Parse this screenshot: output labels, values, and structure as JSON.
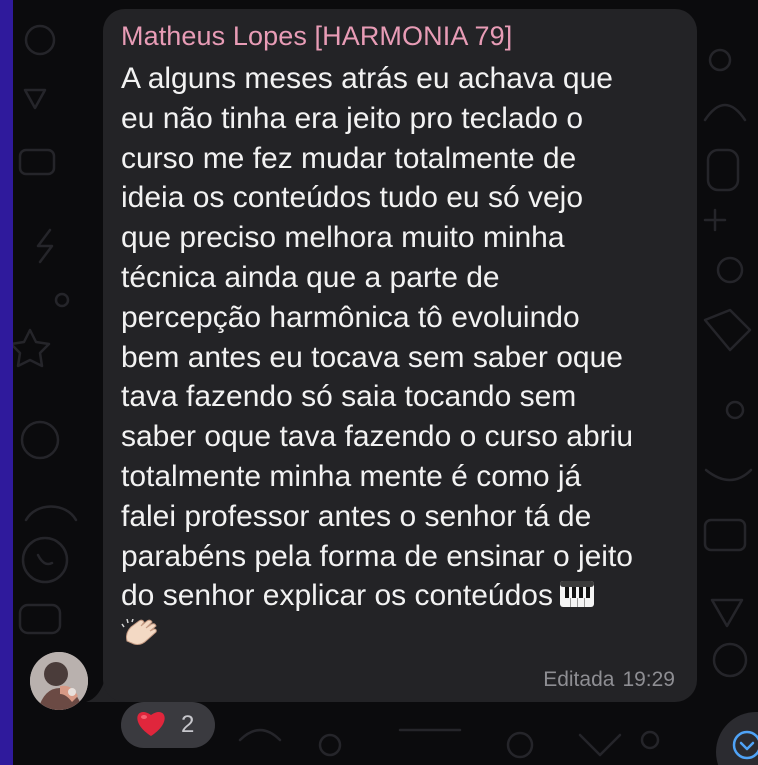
{
  "message": {
    "sender": "Matheus Lopes [HARMONIA 79]",
    "lines": [
      "A alguns meses atrás eu achava que",
      "eu não tinha era jeito pro teclado o",
      "curso me fez mudar totalmente de",
      "ideia os conteúdos tudo eu só vejo",
      "que preciso melhora muito minha",
      "técnica ainda que a parte de",
      "percepção harmônica tô evoluindo",
      "bem antes eu tocava sem saber oque",
      "tava fazendo só saia tocando sem",
      "saber oque tava fazendo o curso abriu",
      "totalmente minha mente é como já",
      "falei professor antes o senhor tá de",
      "parabéns pela forma de ensinar o jeito",
      "do senhor explicar os conteúdos"
    ],
    "emoji_icons": [
      "piano-keyboard-icon",
      "clapping-hands-icon"
    ],
    "edited_label": "Editada",
    "time": "19:29"
  },
  "reaction": {
    "icon": "red-heart-icon",
    "count": "2"
  },
  "colors": {
    "sender_name": "#e89cb6",
    "bubble": "#232326",
    "background": "#0b0b0d",
    "heart": "#e0263c"
  }
}
